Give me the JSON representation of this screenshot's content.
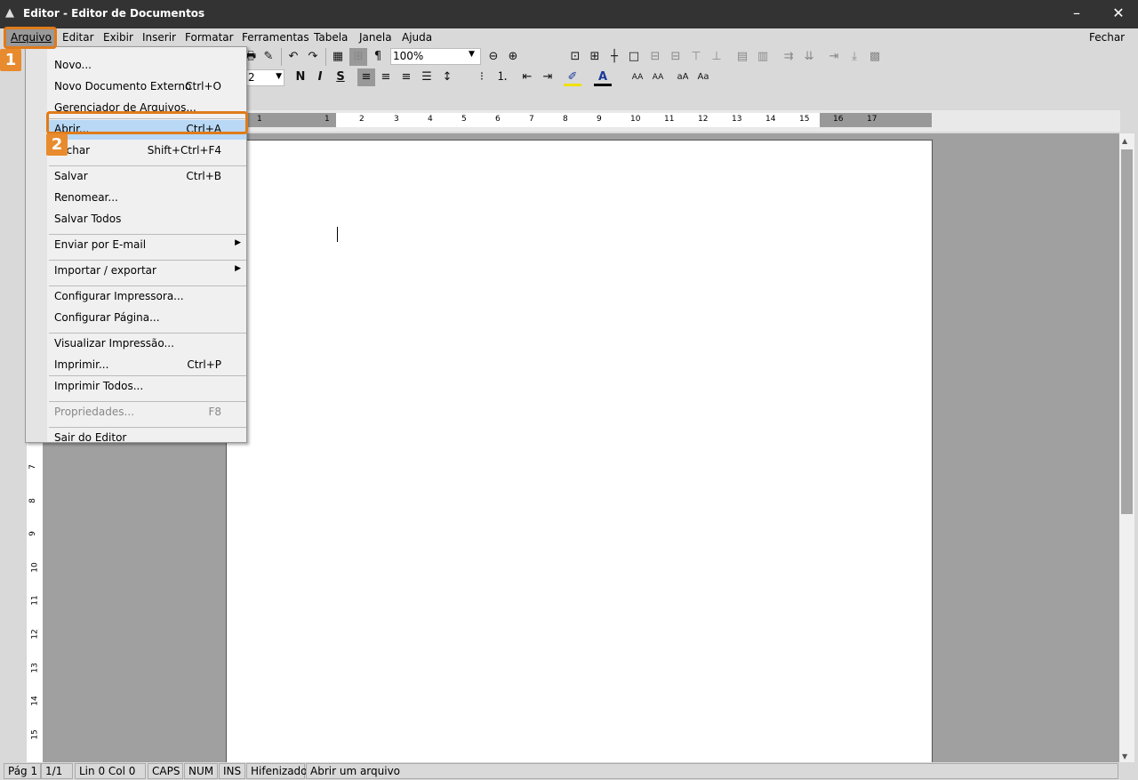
{
  "window": {
    "title": "Editor - Editor de Documentos",
    "icon": "app-logo-icon",
    "minimize": "–",
    "close": "✕"
  },
  "menubar": {
    "items": [
      "Arquivo",
      "Editar",
      "Exibir",
      "Inserir",
      "Formatar",
      "Ferramentas",
      "Tabela",
      "Janela",
      "Ajuda"
    ],
    "close_label": "Fechar"
  },
  "toolbar": {
    "zoom": "100%",
    "font_size": "2",
    "icons_row1": [
      "print-preview-icon",
      "format-painter-icon",
      "undo-icon",
      "redo-icon",
      "table-icon",
      "grid-icon",
      "pilcrow-icon",
      "zoom-out-icon",
      "zoom-in-icon"
    ],
    "icons_row2": [
      "bold-icon",
      "italic-icon",
      "strikethrough-icon",
      "align-left-icon",
      "align-center-icon",
      "align-right-icon",
      "justify-icon",
      "line-spacing-icon",
      "bullets-icon",
      "numbering-icon",
      "outdent-icon",
      "indent-icon",
      "highlight-icon",
      "font-color-icon",
      "superscript-icon",
      "subscript-icon",
      "case-up-icon",
      "case-down-icon"
    ],
    "glyphs": {
      "bold": "N",
      "italic": "I",
      "strike": "S",
      "pilcrow": "¶"
    }
  },
  "ruler": {
    "numbers": [
      "2",
      "1",
      "1",
      "2",
      "3",
      "4",
      "5",
      "6",
      "7",
      "8",
      "9",
      "10",
      "11",
      "12",
      "13",
      "14",
      "15",
      "16",
      "17"
    ],
    "vnumbers": [
      "7",
      "8",
      "9",
      "10",
      "11",
      "12",
      "13",
      "14",
      "15"
    ]
  },
  "file_menu": {
    "items": [
      {
        "label": "Novo...",
        "key": ""
      },
      {
        "label": "Novo Documento Externo",
        "key": "Ctrl+O"
      },
      {
        "label": "Gerenciador de Arquivos...",
        "key": ""
      },
      {
        "label": "Abrir...",
        "key": "Ctrl+A",
        "selected": true
      },
      {
        "label": "Fechar",
        "key": "Shift+Ctrl+F4"
      },
      {
        "label": "Salvar",
        "key": "Ctrl+B"
      },
      {
        "label": "Renomear...",
        "key": ""
      },
      {
        "label": "Salvar Todos",
        "key": ""
      },
      {
        "label": "Enviar por E-mail",
        "key": "",
        "submenu": true
      },
      {
        "label": "Importar / exportar",
        "key": "",
        "submenu": true
      },
      {
        "label": "Configurar Impressora...",
        "key": ""
      },
      {
        "label": "Configurar Página...",
        "key": ""
      },
      {
        "label": "Visualizar Impressão...",
        "key": ""
      },
      {
        "label": "Imprimir...",
        "key": "Ctrl+P"
      },
      {
        "label": "Imprimir Todos...",
        "key": ""
      },
      {
        "label": "Propriedades...",
        "key": "F8",
        "disabled": true
      },
      {
        "label": "Sair do Editor",
        "key": ""
      }
    ]
  },
  "annotations": {
    "step1": "1",
    "step2": "2",
    "color": "#e07b1a"
  },
  "status": {
    "page": "Pág 1",
    "of": "1/1",
    "pos": "Lin 0  Col 0",
    "caps": "CAPS",
    "num": "NUM",
    "ins": "INS",
    "hyph": "Hifenizado",
    "msg": "Abrir um arquivo"
  }
}
